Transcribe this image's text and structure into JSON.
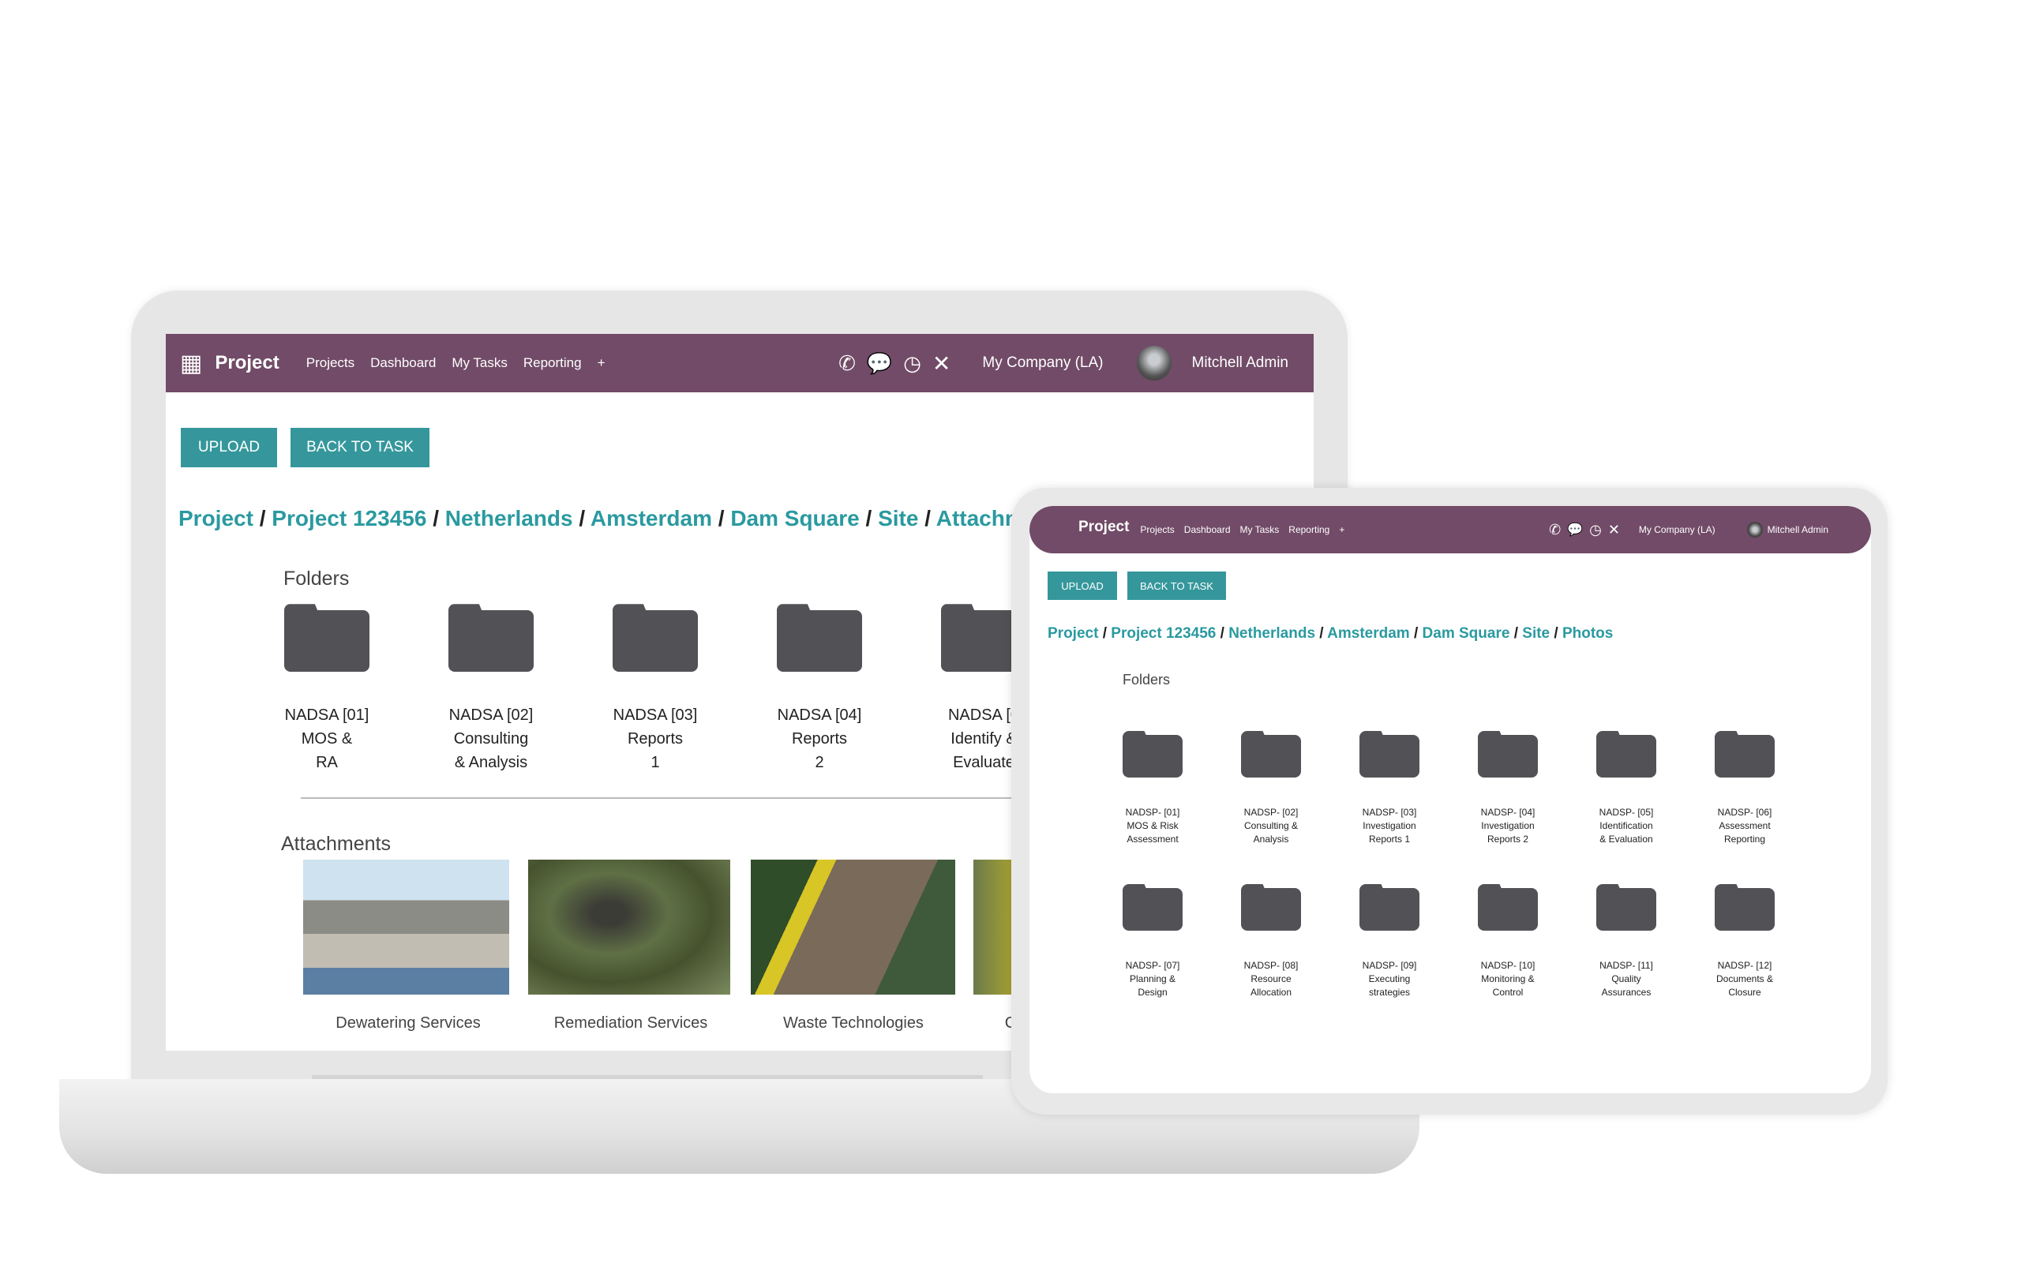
{
  "laptop": {
    "nav": {
      "app_title": "Project",
      "menu": [
        "Projects",
        "Dashboard",
        "My Tasks",
        "Reporting",
        "+"
      ],
      "company": "My Company (LA)",
      "user": "Mitchell Admin",
      "icons": [
        "phone-icon",
        "chat-icon",
        "clock-icon",
        "tools-icon"
      ]
    },
    "buttons": {
      "upload": "UPLOAD",
      "back": "BACK TO TASK"
    },
    "breadcrumb": [
      "Project",
      "Project 123456",
      "Netherlands",
      "Amsterdam",
      "Dam Square",
      "Site",
      "Attachm"
    ],
    "folders_title": "Folders",
    "folders": [
      [
        "NADSA [01]",
        "MOS &",
        "RA"
      ],
      [
        "NADSA [02]",
        "Consulting",
        "& Analysis"
      ],
      [
        "NADSA [03]",
        "Reports",
        "1"
      ],
      [
        "NADSA [04]",
        "Reports",
        "2"
      ],
      [
        "NADSA [0",
        "Identify &",
        "Evaluate"
      ]
    ],
    "attachments_title": "Attachments",
    "attachments": [
      "Dewatering Services",
      "Remediation Services",
      "Waste Technologies",
      "C"
    ]
  },
  "tablet": {
    "nav": {
      "app_title": "Project",
      "menu": [
        "Projects",
        "Dashboard",
        "My Tasks",
        "Reporting",
        "+"
      ],
      "company": "My Company (LA)",
      "user": "Mitchell Admin"
    },
    "buttons": {
      "upload": "UPLOAD",
      "back": "BACK TO TASK"
    },
    "breadcrumb": [
      "Project",
      "Project 123456",
      "Netherlands",
      "Amsterdam",
      "Dam Square",
      "Site",
      "Photos"
    ],
    "folders_title": "Folders",
    "folders": [
      [
        "NADSP- [01]",
        "MOS & Risk",
        "Assessment"
      ],
      [
        "NADSP- [02]",
        "Consulting &",
        "Analysis"
      ],
      [
        "NADSP- [03]",
        "Investigation",
        "Reports 1"
      ],
      [
        "NADSP- [04]",
        "Investigation",
        "Reports 2"
      ],
      [
        "NADSP- [05]",
        "Identification",
        "& Evaluation"
      ],
      [
        "NADSP- [06]",
        "Assessment",
        "Reporting"
      ],
      [
        "NADSP- [07]",
        "Planning &",
        "Design"
      ],
      [
        "NADSP- [08]",
        "Resource",
        "Allocation"
      ],
      [
        "NADSP- [09]",
        "Executing",
        "strategies"
      ],
      [
        "NADSP- [10]",
        "Monitoring &",
        "Control"
      ],
      [
        "NADSP- [11]",
        "Quality",
        "Assurances"
      ],
      [
        "NADSP- [12]",
        "Documents &",
        "Closure"
      ]
    ]
  },
  "colors": {
    "nav": "#714b67",
    "accent": "#35979c",
    "link": "#2a9aa0",
    "folder": "#525256"
  }
}
